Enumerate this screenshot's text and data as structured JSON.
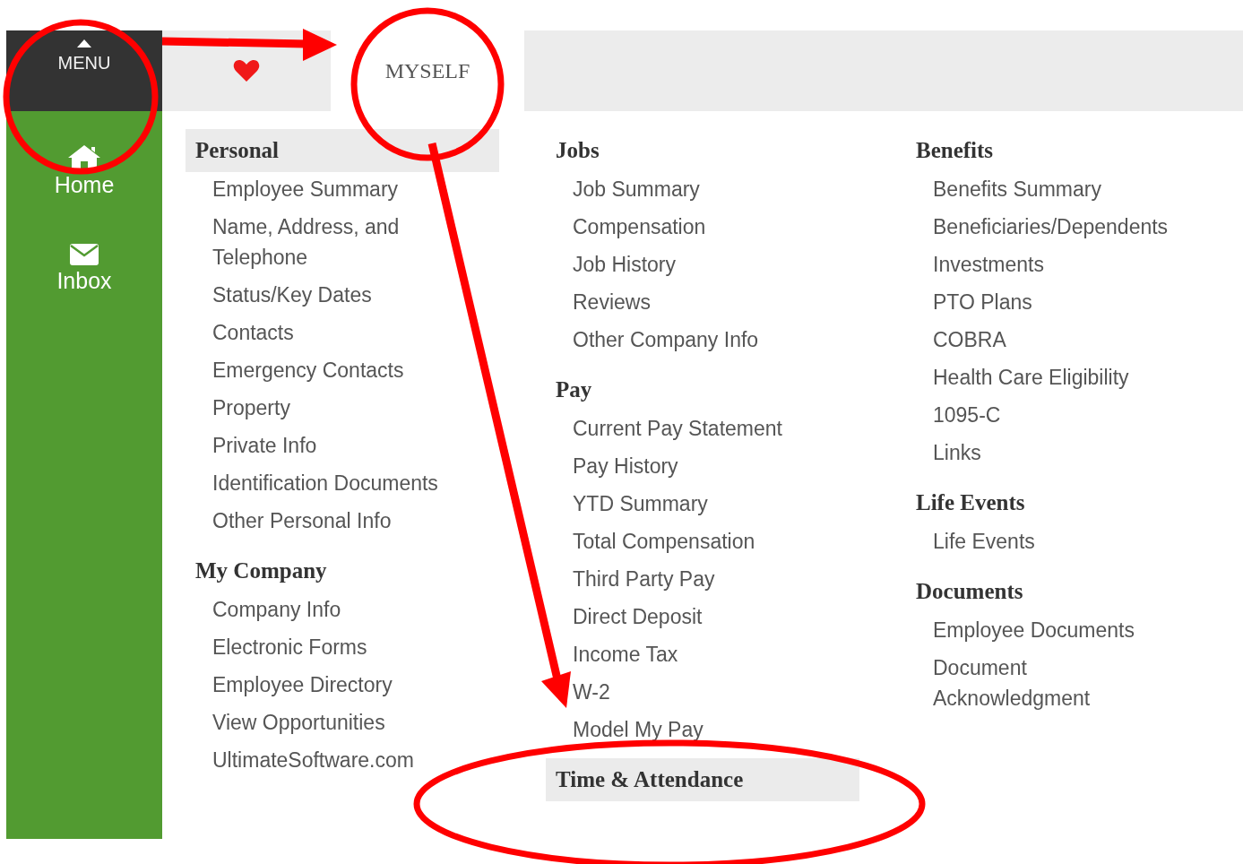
{
  "sidebar": {
    "menu_label": "MENU",
    "items": [
      {
        "kind": "home",
        "label": "Home"
      },
      {
        "kind": "inbox",
        "label": "Inbox"
      }
    ]
  },
  "tabs": [
    {
      "kind": "favorites",
      "selected": false
    },
    {
      "kind": "text",
      "label": "MYSELF",
      "selected": true
    }
  ],
  "columns": [
    {
      "sections": [
        {
          "title": "Personal",
          "highlighted": true,
          "items": [
            "Employee Summary",
            "Name, Address, and Telephone",
            "Status/Key Dates",
            "Contacts",
            "Emergency Contacts",
            "Property",
            "Private Info",
            "Identification Documents",
            "Other Personal Info"
          ]
        },
        {
          "title": "My Company",
          "highlighted": false,
          "items": [
            "Company Info",
            "Electronic Forms",
            "Employee Directory",
            "View Opportunities",
            "UltimateSoftware.com"
          ]
        }
      ]
    },
    {
      "sections": [
        {
          "title": "Jobs",
          "highlighted": false,
          "items": [
            "Job Summary",
            "Compensation",
            "Job History",
            "Reviews",
            "Other Company Info"
          ]
        },
        {
          "title": "Pay",
          "highlighted": false,
          "items": [
            "Current Pay Statement",
            "Pay History",
            "YTD Summary",
            "Total Compensation",
            "Third Party Pay",
            "Direct Deposit",
            "Income Tax",
            "W-2",
            "Model My Pay"
          ]
        },
        {
          "title": "Time & Attendance",
          "highlighted": true
        }
      ]
    },
    {
      "sections": [
        {
          "title": "Benefits",
          "highlighted": false,
          "items": [
            "Benefits Summary",
            "Beneficiaries/Dependents",
            "Investments",
            "PTO Plans",
            "COBRA",
            "Health Care Eligibility",
            "1095-C",
            "Links"
          ]
        },
        {
          "title": "Life Events",
          "highlighted": false,
          "items": [
            "Life Events"
          ]
        },
        {
          "title": "Documents",
          "highlighted": false,
          "items": [
            "Employee Documents",
            "Document Acknowledgment"
          ]
        }
      ]
    }
  ]
}
